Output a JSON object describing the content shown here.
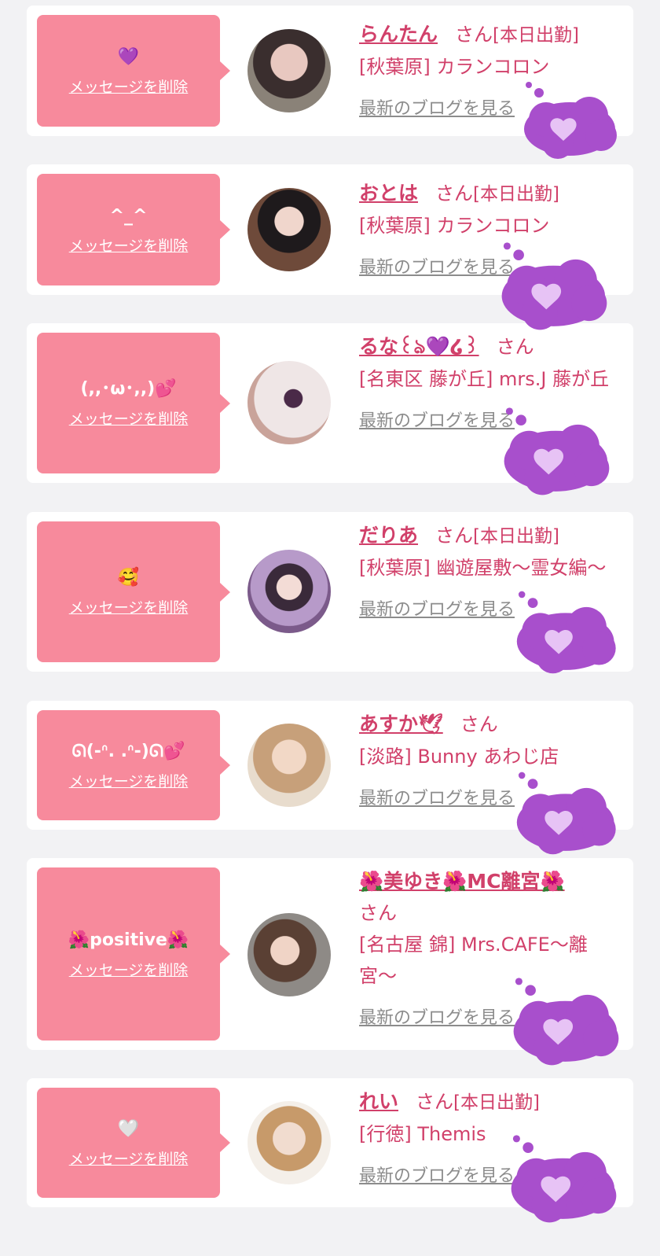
{
  "colors": {
    "background": "#f2f2f4",
    "card": "#ffffff",
    "bubble": "#f78a9c",
    "name": "#d1406a",
    "link_gray": "#8c8c8c",
    "cloud": "#a84fcc"
  },
  "common": {
    "delete_label": "メッセージを削除",
    "blog_label": "最新のブログを見る",
    "san_label": "さん"
  },
  "cards": [
    {
      "message": "💜",
      "name": "らんたん",
      "status": "[本日出勤]",
      "shop": "[秋葉原] カランコロン",
      "avatar_icon": "avatar-photo-icon"
    },
    {
      "message": "^_^",
      "name": "おとは",
      "status": "[本日出勤]",
      "shop": "[秋葉原] カランコロン",
      "avatar_icon": "avatar-photo-icon"
    },
    {
      "message": "(,,･ω･,,)💕",
      "name": "るな꒰ঌ💜໒꒱",
      "status": "",
      "shop": "[名東区 藤が丘] mrs.J 藤が丘",
      "avatar_icon": "avatar-photo-icon"
    },
    {
      "message": "🥰",
      "name": "だりあ",
      "status": "[本日出勤]",
      "shop": "[秋葉原] 幽遊屋敷〜霊女編〜",
      "avatar_icon": "avatar-photo-icon"
    },
    {
      "message": "ᘏ(-ᐢ. .ᐢ-)ᘏ💕",
      "name": "あすか🕊",
      "status": "",
      "shop": "[淡路] Bunny あわじ店",
      "avatar_icon": "avatar-photo-icon"
    },
    {
      "message": "🌺positive🌺",
      "name": "🌺美ゆき🌺MC離宮🌺",
      "status": "",
      "shop": "[名古屋 錦] Mrs.CAFE〜離宮〜",
      "avatar_icon": "avatar-photo-icon"
    },
    {
      "message": "🤍",
      "name": "れい",
      "status": "[本日出勤]",
      "shop": "[行徳] Themis",
      "avatar_icon": "avatar-photo-icon"
    }
  ],
  "sticker": {
    "icon": "purple-heart-cloud-icon",
    "heart": "💜"
  }
}
